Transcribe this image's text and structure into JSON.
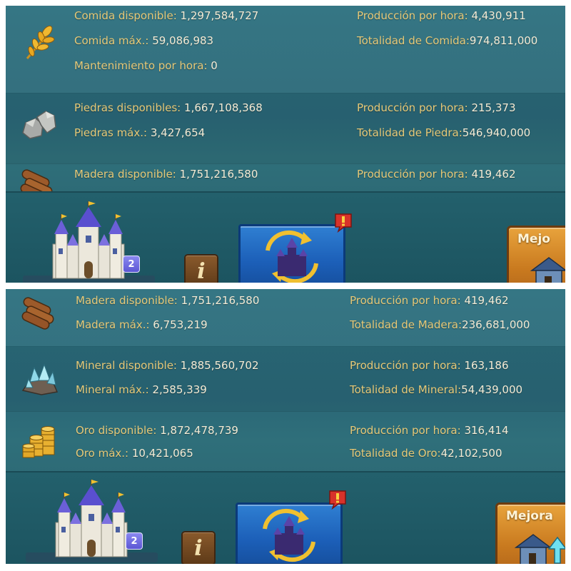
{
  "top_panel": {
    "resources": [
      {
        "icon": "wheat-icon",
        "rows": [
          {
            "left_label": "Comida disponible:",
            "left_value": "1,297,584,727",
            "right_label": "Producción por hora:",
            "right_value": "4,430,911"
          },
          {
            "left_label": "Comida máx.:",
            "left_value": "59,086,983",
            "right_label": "Totalidad de Comida:",
            "right_value": "974,811,000"
          },
          {
            "left_label": "Mantenimiento por hora:",
            "left_value": "0"
          }
        ]
      },
      {
        "icon": "stone-icon",
        "rows": [
          {
            "left_label": "Piedras disponibles:",
            "left_value": "1,667,108,368",
            "right_label": "Producción por hora:",
            "right_value": "215,373"
          },
          {
            "left_label": "Piedras máx.:",
            "left_value": "3,427,654",
            "right_label": "Totalidad de Piedra:",
            "right_value": "546,940,000"
          }
        ]
      },
      {
        "icon": "wood-logs-icon",
        "rows": [
          {
            "left_label": "Madera disponible:",
            "left_value": "1,751,216,580",
            "right_label": "Producción por hora:",
            "right_value": "419,462"
          }
        ]
      }
    ],
    "bottom_bar": {
      "castle_level": "2",
      "info_label": "i",
      "upgrade_label": "Mejo"
    }
  },
  "bottom_panel": {
    "resources": [
      {
        "icon": "wood-logs-icon",
        "rows": [
          {
            "left_label": "Madera disponible:",
            "left_value": "1,751,216,580",
            "right_label": "Producción por hora:",
            "right_value": "419,462"
          },
          {
            "left_label": "Madera máx.:",
            "left_value": "6,753,219",
            "right_label": "Totalidad de Madera:",
            "right_value": "236,681,000"
          }
        ]
      },
      {
        "icon": "ore-crystal-icon",
        "rows": [
          {
            "left_label": "Mineral disponible:",
            "left_value": "1,885,560,702",
            "right_label": "Producción por hora:",
            "right_value": "163,186"
          },
          {
            "left_label": "Mineral máx.:",
            "left_value": "2,585,339",
            "right_label": "Totalidad de Mineral:",
            "right_value": "54,439,000"
          }
        ]
      },
      {
        "icon": "gold-coins-icon",
        "rows": [
          {
            "left_label": "Oro disponible:",
            "left_value": "1,872,478,739",
            "right_label": "Producción por hora:",
            "right_value": "316,414"
          },
          {
            "left_label": "Oro máx.:",
            "left_value": "10,421,065",
            "right_label": "Totalidad de Oro:",
            "right_value": "42,102,500"
          }
        ]
      }
    ],
    "bottom_bar": {
      "castle_level": "2",
      "info_label": "i",
      "upgrade_label": "Mejora"
    }
  },
  "colors": {
    "label_gold": "#e6c978",
    "value_cream": "#f4ecd6",
    "panel_teal": "#2a6777",
    "button_blue": "#1c5fb8",
    "button_orange": "#c97a1f",
    "alert_red": "#d8322a"
  }
}
